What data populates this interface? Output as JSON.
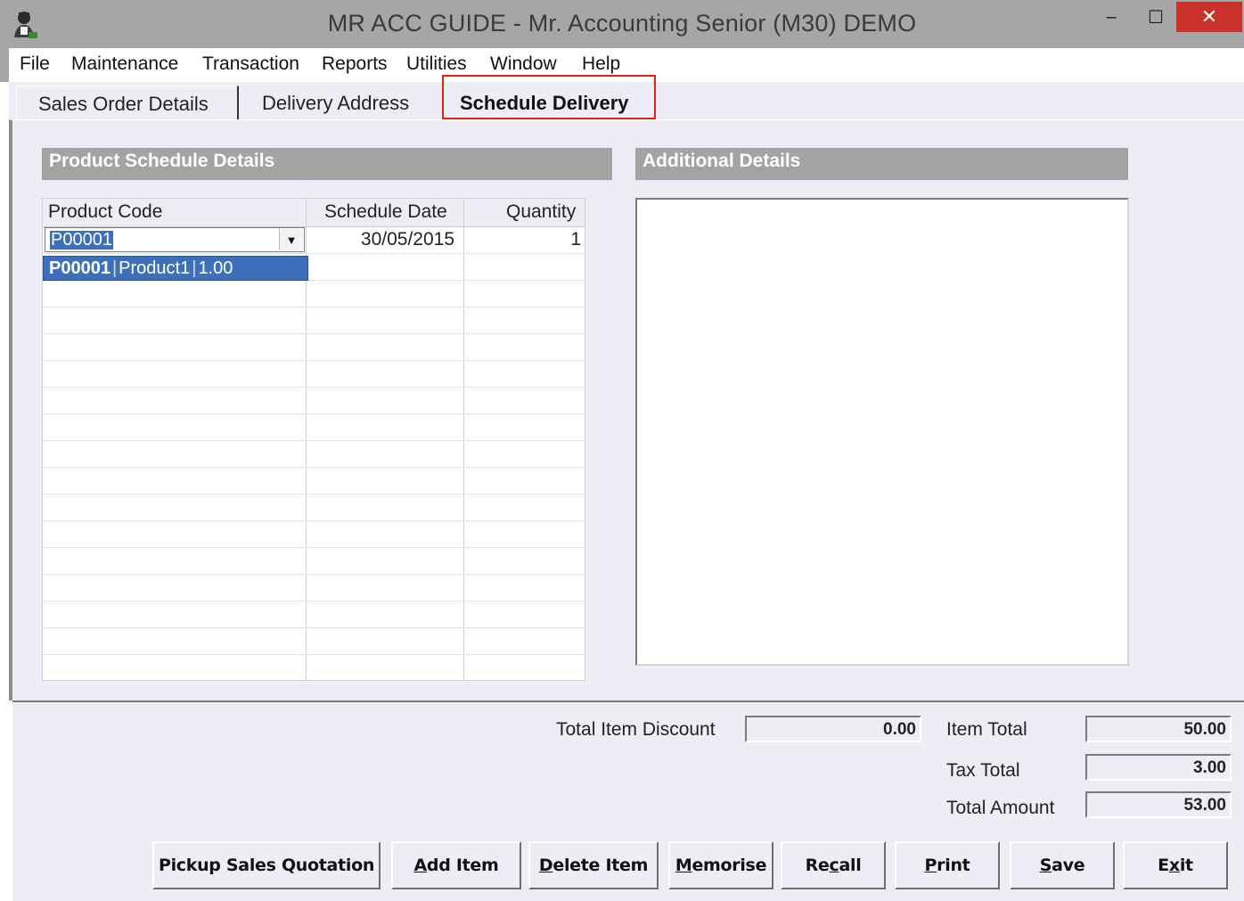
{
  "window": {
    "title": "MR ACC GUIDE - Mr. Accounting Senior (M30) DEMO",
    "minimize": "–",
    "maximize": "☐",
    "close": "✕"
  },
  "menu": [
    "File",
    "Maintenance",
    "Transaction",
    "Reports",
    "Utilities",
    "Window",
    "Help"
  ],
  "tabs": [
    {
      "label": "Sales Order Details"
    },
    {
      "label": "Delivery Address"
    },
    {
      "label": "Schedule Delivery",
      "active": true
    }
  ],
  "product_schedule": {
    "header": "Product Schedule Details",
    "columns": [
      "Product Code",
      "Schedule Date",
      "Quantity"
    ],
    "row": {
      "product_code": "P00001",
      "schedule_date": "30/05/2015",
      "quantity": "1"
    },
    "dropdown_option": {
      "code": "P00001",
      "name": "Product1",
      "price": "1.00"
    }
  },
  "additional_details": {
    "header": "Additional Details"
  },
  "totals": {
    "item_discount_label": "Total Item Discount",
    "item_discount": "0.00",
    "item_total_label": "Item Total",
    "item_total": "50.00",
    "tax_total_label": "Tax Total",
    "tax_total": "3.00",
    "total_amount_label": "Total Amount",
    "total_amount": "53.00"
  },
  "buttons": {
    "pickup": "Pickup Sales Quotation",
    "add_pre": "",
    "add_u": "A",
    "add_post": "dd Item",
    "delete_pre": "",
    "delete_u": "D",
    "delete_post": "elete Item",
    "memorise_pre": "",
    "memorise_u": "M",
    "memorise_post": "emorise",
    "recall_pre": "Re",
    "recall_u": "c",
    "recall_post": "all",
    "print_pre": "",
    "print_u": "P",
    "print_post": "rint",
    "save_pre": "",
    "save_u": "S",
    "save_post": "ave",
    "exit_pre": "E",
    "exit_u": "x",
    "exit_post": "it"
  },
  "colors": {
    "titlebar": "#a6a6a6",
    "close_button": "#c9312a",
    "panel": "#ededf6",
    "section_header": "#a3a3a3",
    "selection": "#3d6fba",
    "highlight_box": "#e2231a"
  }
}
